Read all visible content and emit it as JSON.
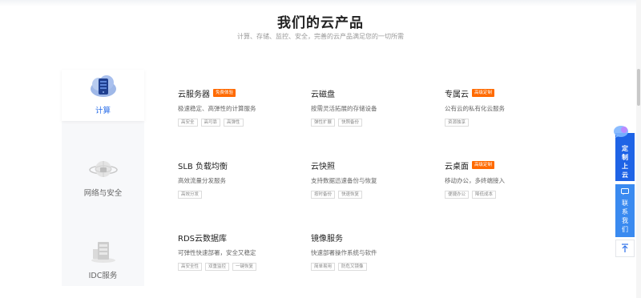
{
  "page": {
    "title": "我们的云产品",
    "subtitle": "计算、存储、监控、安全，完善的云产品满足您的一切所需"
  },
  "categories": [
    {
      "label": "计算",
      "active": true,
      "icon": "server-cloud-icon"
    },
    {
      "label": "网络与安全",
      "active": false,
      "icon": "network-globe-icon"
    },
    {
      "label": "IDC服务",
      "active": false,
      "icon": "datacenter-rack-icon"
    }
  ],
  "products": [
    {
      "name": "云服务器",
      "badge": "免费体验",
      "desc": "极速稳定、高弹性的计算服务",
      "tags": [
        "高安全",
        "高可靠",
        "高弹性"
      ]
    },
    {
      "name": "云磁盘",
      "badge": "",
      "desc": "按需灵活拓展的存储设备",
      "tags": [
        "弹性扩展",
        "快照备份"
      ]
    },
    {
      "name": "专属云",
      "badge": "高级定制",
      "desc": "公有云的私有化云服务",
      "tags": [
        "资源独享"
      ]
    },
    {
      "name": "SLB 负载均衡",
      "badge": "",
      "desc": "高效流量分发服务",
      "tags": [
        "高效分发"
      ]
    },
    {
      "name": "云快照",
      "badge": "",
      "desc": "支持数据迅速备份与恢复",
      "tags": [
        "按时备份",
        "快速恢复"
      ]
    },
    {
      "name": "云桌面",
      "badge": "高级定制",
      "desc": "移动办公，多终端接入",
      "tags": [
        "便捷办公",
        "降低成本"
      ]
    },
    {
      "name": "RDS云数据库",
      "badge": "",
      "desc": "可弹性快速部署，安全又稳定",
      "tags": [
        "高安全性",
        "双重监控",
        "一键恢复"
      ]
    },
    {
      "name": "镜像服务",
      "badge": "",
      "desc": "快速部署操作系统与软件",
      "tags": [
        "简单易用",
        "防危又镜像"
      ]
    }
  ],
  "float": {
    "custom": [
      "定",
      "制",
      "上",
      "云"
    ],
    "contact": [
      "联",
      "系",
      "我",
      "们"
    ]
  },
  "colors": {
    "accent": "#2c6fe8",
    "badge": "#ff6a00",
    "float_blue": "#1e63e6"
  }
}
